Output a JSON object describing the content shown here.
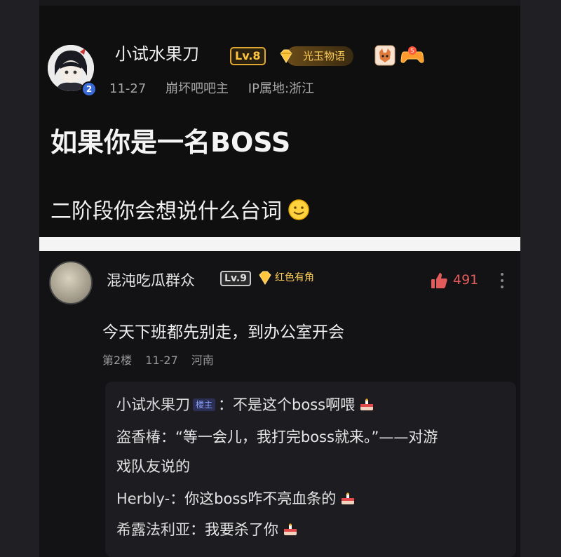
{
  "post": {
    "author": "小试水果刀",
    "level": "Lv.8",
    "tag": "光玉物语",
    "avatar_badge": "2",
    "date": "11-27",
    "role": "崩坏吧吧主",
    "location": "IP属地:浙江",
    "title": "如果你是一名BOSS",
    "body": "二阶段你会想说什么台词"
  },
  "comment": {
    "author": "混沌吃瓜群众",
    "level": "Lv.9",
    "tag": "红色有角",
    "likes": "491",
    "text": "今天下班都先别走，到办公室开会",
    "floor": "第2楼",
    "date": "11-27",
    "location": "河南"
  },
  "replies": [
    {
      "name": "小试水果刀",
      "host_badge": "楼主",
      "text": "：不是这个boss啊喂"
    },
    {
      "name": "盗香椿",
      "text": "：“等一会儿，我打完boss就来。”——对游"
    },
    {
      "name": "",
      "text": "戏队友说的"
    },
    {
      "name": "Herbly-",
      "text": "：你这boss咋不亮血条的"
    },
    {
      "name": "希露法利亚",
      "text": "：我要杀了你"
    }
  ],
  "colors": {
    "accent_gold": "#ffc53d",
    "like_red": "#e45b5b"
  }
}
